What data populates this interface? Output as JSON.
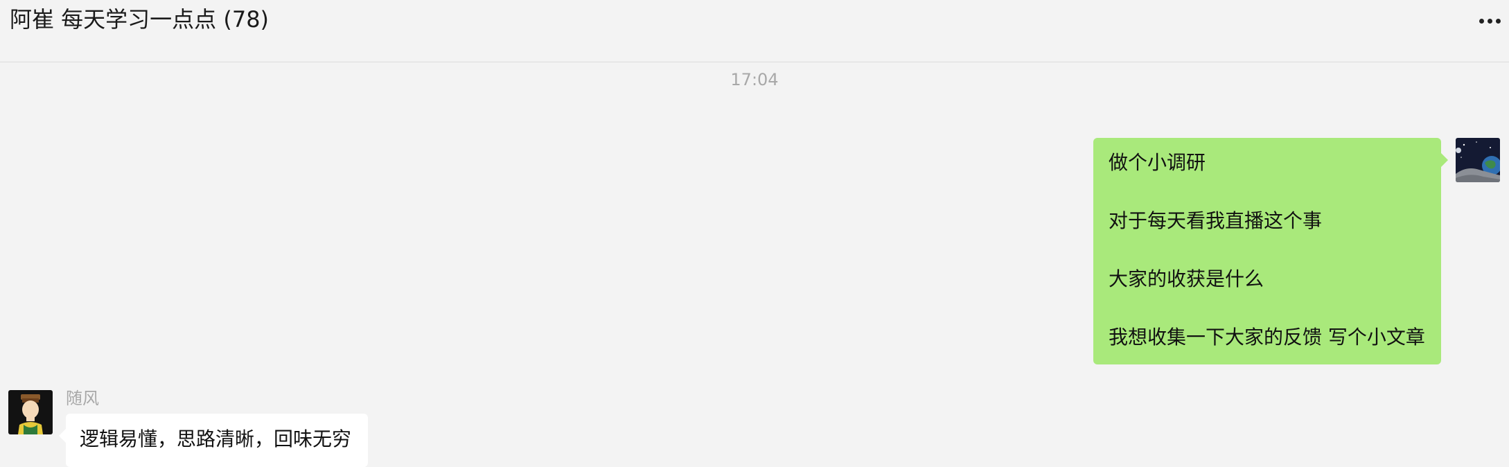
{
  "header": {
    "title": "阿崔 每天学习一点点 (78)",
    "more_icon": "more-dots-icon"
  },
  "timestamp": "17:04",
  "messages": {
    "self": {
      "avatar_icon": "space-earth-avatar",
      "lines": [
        "做个小调研",
        "对于每天看我直播这个事",
        "大家的收获是什么",
        "我想收集一下大家的反馈 写个小文章"
      ],
      "bubble_color": "#a9e97b"
    },
    "other": {
      "sender": "随风",
      "avatar_icon": "cartoon-person-avatar",
      "text": "逻辑易懂，思路清晰，回味无穷",
      "bubble_color": "#ffffff"
    }
  },
  "colors": {
    "background": "#f3f3f3",
    "secondary_text": "#a8a8a8"
  }
}
